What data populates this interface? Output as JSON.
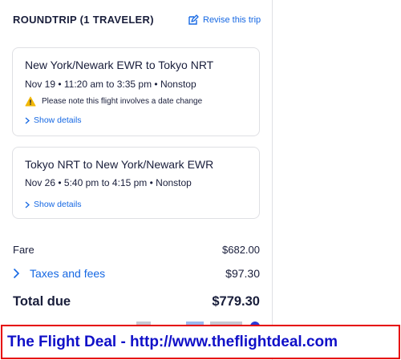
{
  "header": {
    "title": "ROUNDTRIP (1 TRAVELER)",
    "revise_label": "Revise this trip"
  },
  "flights": [
    {
      "route": "New York/Newark EWR to Tokyo NRT",
      "times": "Nov 19 • 11:20 am to 3:35 pm • Nonstop",
      "warning": "Please note this flight involves a date change",
      "details_label": "Show details"
    },
    {
      "route": "Tokyo NRT to New York/Newark EWR",
      "times": "Nov 26 • 5:40 pm to 4:15 pm • Nonstop",
      "details_label": "Show details"
    }
  ],
  "pricing": {
    "fare_label": "Fare",
    "fare_value": "$682.00",
    "taxes_label": "Taxes and fees",
    "taxes_value": "$97.30",
    "total_label": "Total due",
    "total_value": "$779.30"
  },
  "banner": {
    "text": "The Flight Deal - http://www.theflightdeal.com"
  },
  "colors": {
    "link": "#1668e3",
    "warning": "#f2b807",
    "banner_border": "#e60000",
    "banner_text": "#1010c8"
  }
}
